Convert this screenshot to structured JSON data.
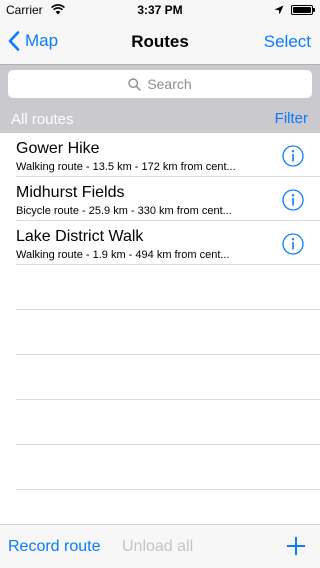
{
  "status_bar": {
    "carrier": "Carrier",
    "time": "3:37 PM",
    "icons": [
      "wifi-icon",
      "location-arrow-icon",
      "battery-icon"
    ]
  },
  "nav": {
    "back_label": "Map",
    "title": "Routes",
    "action_label": "Select"
  },
  "search": {
    "placeholder": "Search"
  },
  "section": {
    "title": "All routes",
    "filter_label": "Filter"
  },
  "routes": [
    {
      "name": "Gower Hike",
      "details": "Walking route - 13.5 km - 172 km from cent..."
    },
    {
      "name": "Midhurst Fields",
      "details": "Bicycle route - 25.9 km - 330 km from cent..."
    },
    {
      "name": "Lake District Walk",
      "details": "Walking route - 1.9 km - 494 km from cent..."
    }
  ],
  "toolbar": {
    "record_label": "Record route",
    "unload_label": "Unload all",
    "add_icon": "plus-icon"
  },
  "colors": {
    "accent": "#0a7aff",
    "section_bg": "#c9c9ce",
    "disabled": "#c4c4c8"
  }
}
